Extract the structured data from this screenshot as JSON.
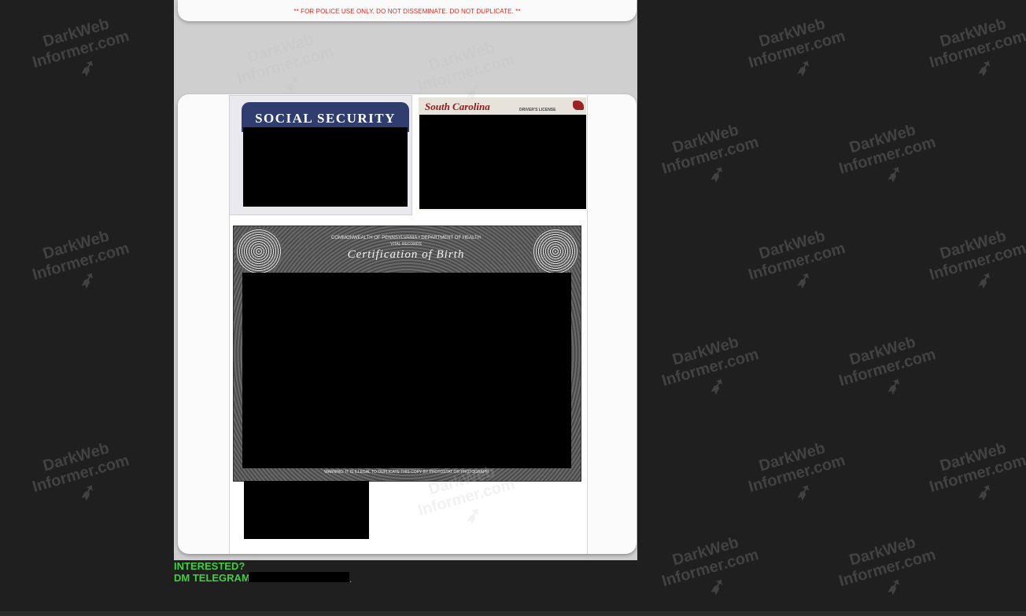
{
  "report_header": {
    "address_line": "",
    "notice": "** FOR POLICE USE ONLY.  DO NOT DISSEMINATE.  DO NOT DUPLICATE. **"
  },
  "ssn_card": {
    "title": "SOCIAL SECURITY"
  },
  "drivers_license": {
    "state": "South Carolina",
    "doc_type": "DRIVER'S LICENSE"
  },
  "birth_certificate": {
    "department": "COMMONWEALTH OF PENNSYLVANIA • DEPARTMENT OF HEALTH",
    "office": "VITAL RECORDS",
    "title": "Certification of Birth",
    "warning": "WARNING: IT IS ILLEGAL TO DUPLICATE THIS COPY BY PHOTOSTAT OR PHOTOGRAPH"
  },
  "call_to_action": {
    "interested": "INTERESTED?",
    "telegram_label": "DM TELEGRAM:",
    "trailing_dot": "."
  },
  "watermark": {
    "line1": "DarkWeb",
    "line2": "Informer.com"
  },
  "colors": {
    "background": "#1f1f1f",
    "cta_green": "#41cf41",
    "notice_red": "#e0261e",
    "ssn_blue": "#2f3e6e",
    "license_red": "#8a1b1b"
  }
}
